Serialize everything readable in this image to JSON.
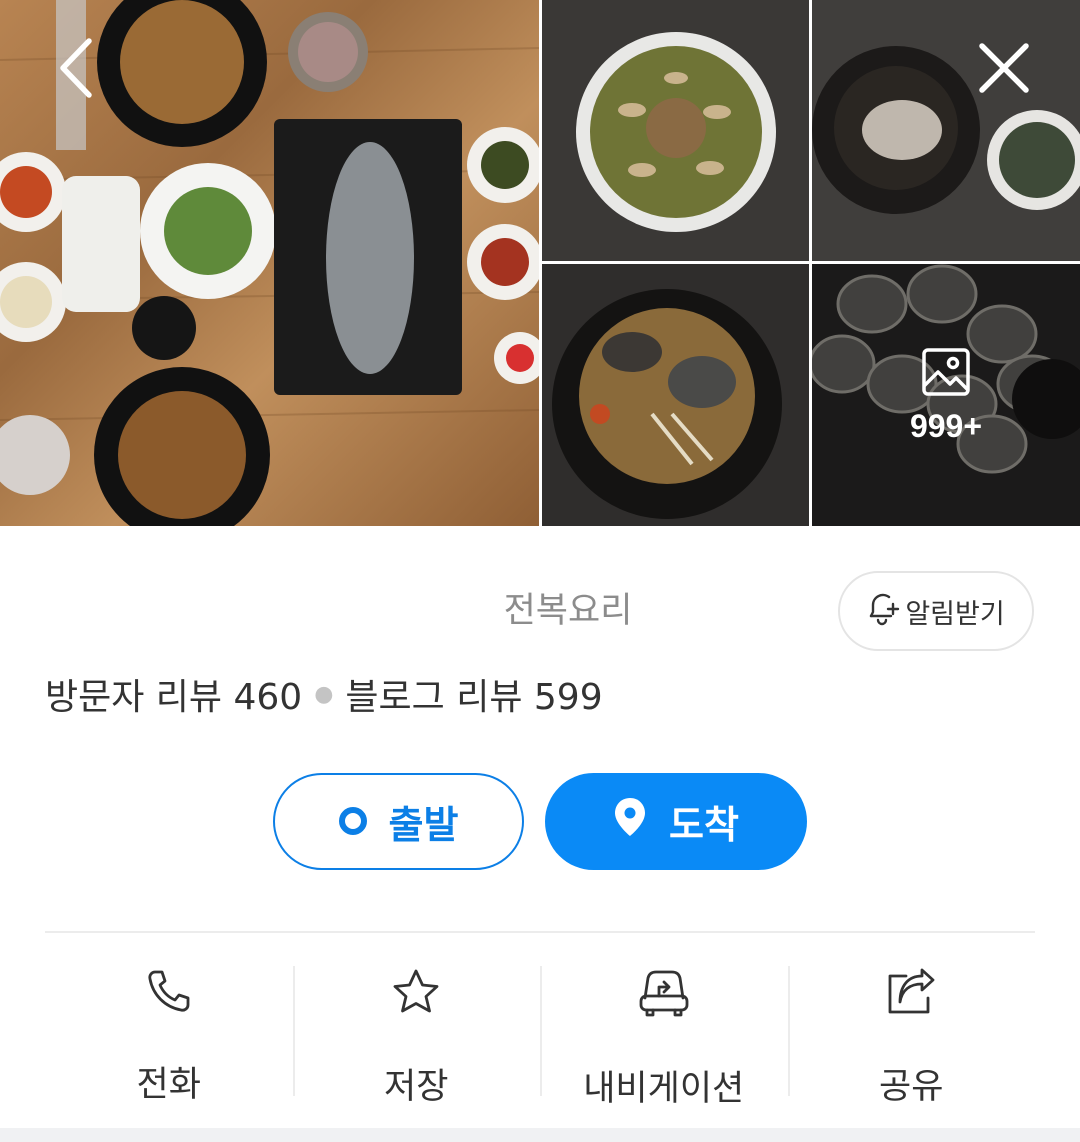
{
  "gallery": {
    "more_count": "999+",
    "icons": {
      "back": "chevron-left-icon",
      "close": "close-icon",
      "photos": "image-icon"
    }
  },
  "place": {
    "category": "전복요리",
    "alarm_label": "알림받기",
    "visitor_reviews": "방문자 리뷰 460",
    "blog_reviews": "블로그 리뷰 599"
  },
  "route": {
    "start_label": "출발",
    "arrive_label": "도착",
    "accent": "#0a8af6"
  },
  "actions": [
    {
      "label": "전화",
      "icon": "phone-icon"
    },
    {
      "label": "저장",
      "icon": "star-icon"
    },
    {
      "label": "내비게이션",
      "icon": "car-navigation-icon"
    },
    {
      "label": "공유",
      "icon": "share-icon"
    }
  ]
}
